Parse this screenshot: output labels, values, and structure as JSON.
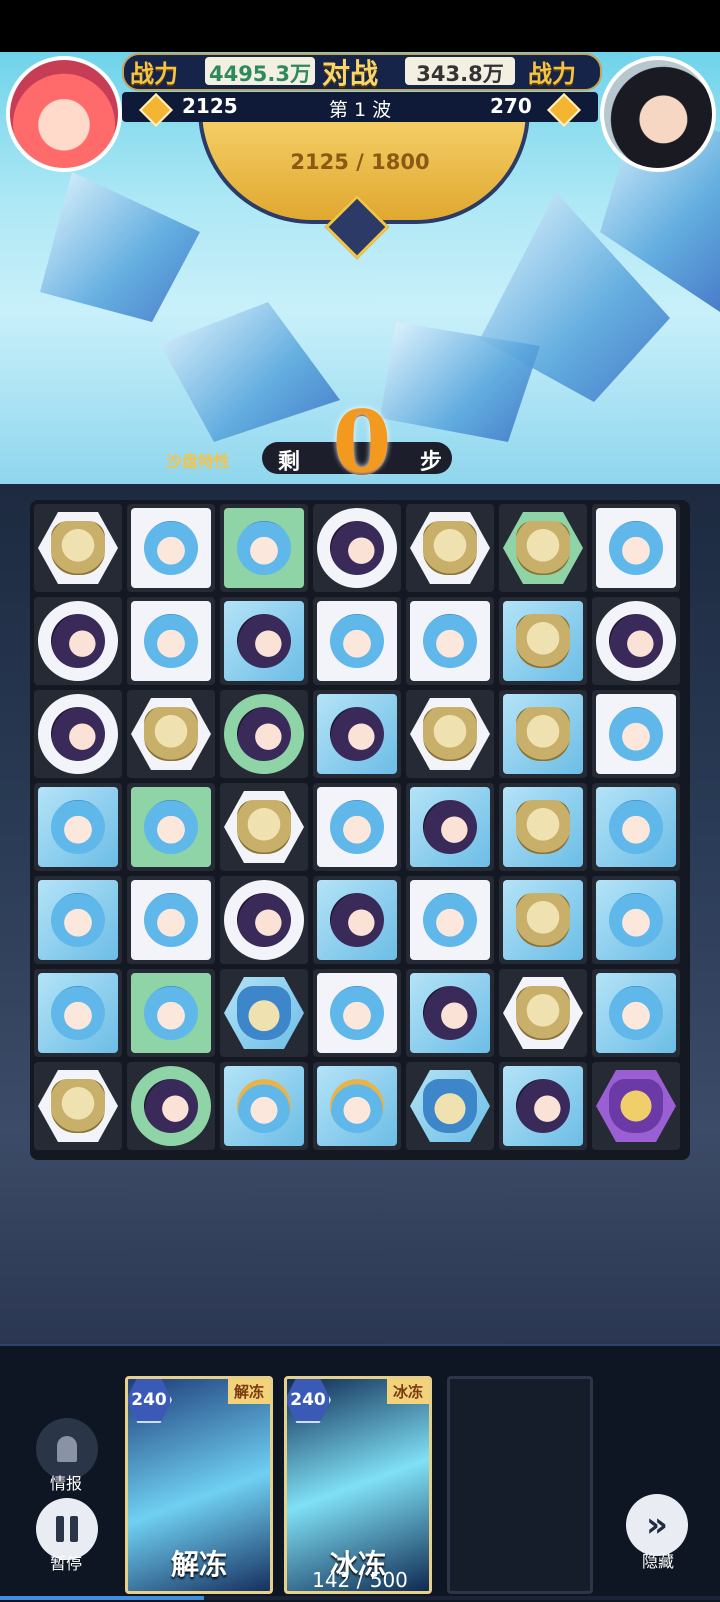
{
  "hud": {
    "power_label_left": "战力",
    "power_value_left": "4495.3万",
    "versus_label": "对战",
    "power_value_right": "343.8万",
    "power_label_right": "战力",
    "coin_left": "2125",
    "wave_label": "第 1 波",
    "coin_right": "270",
    "gauge_progress": "2125 / 1800"
  },
  "moves": {
    "sandbox_tag": "沙盘特性",
    "prefix": "剩",
    "count": "0",
    "suffix": "步"
  },
  "board": {
    "rows": 7,
    "cols": 7,
    "tiles": [
      [
        "mask-hex-white",
        "blue-sq-white",
        "blue-sq-green",
        "dark-circle-white",
        "mask-hex-white",
        "mask-hex-green",
        "blue-sq-white"
      ],
      [
        "dark-circle-white",
        "blue-sq-white",
        "dark-sq-ice",
        "blue-sq-white",
        "blue-sq-white",
        "mask-sq-ice",
        "dark-circle-white"
      ],
      [
        "dark-circle-white",
        "mask-hex-white",
        "dark-circle-green",
        "dark-sq-ice",
        "mask-hex-white",
        "mask-sq-ice",
        "blue-sq-white"
      ],
      [
        "blue-sq-ice",
        "blue-sq-green",
        "mask-hex-white",
        "blue-sq-white",
        "dark-sq-ice",
        "mask-sq-ice",
        "blue-sq-ice"
      ],
      [
        "blue-sq-ice",
        "blue-sq-white",
        "dark-circle-white",
        "dark-sq-ice",
        "blue-sq-white",
        "mask-sq-ice",
        "blue-sq-ice"
      ],
      [
        "blue-sq-ice",
        "blue-sq-green",
        "bluemask-hex-ice",
        "blue-sq-white",
        "dark-sq-ice",
        "mask-hex-white",
        "blue-sq-ice"
      ],
      [
        "mask-hex-white",
        "dark-circle-green",
        "cap-sq-ice",
        "cap-sq-ice",
        "bluemask-hex-ice",
        "dark-sq-ice",
        "purplemask-hex-purple"
      ]
    ]
  },
  "skills": [
    {
      "name": "解冻",
      "tag": "解冻",
      "cost": "240"
    },
    {
      "name": "冰冻",
      "tag": "冰冻",
      "cost": "240"
    }
  ],
  "controls": {
    "info_label": "情报",
    "pause_label": "暂停",
    "hide_label": "隐藏"
  },
  "energy": {
    "text": "142 / 500",
    "fraction": 0.284
  }
}
